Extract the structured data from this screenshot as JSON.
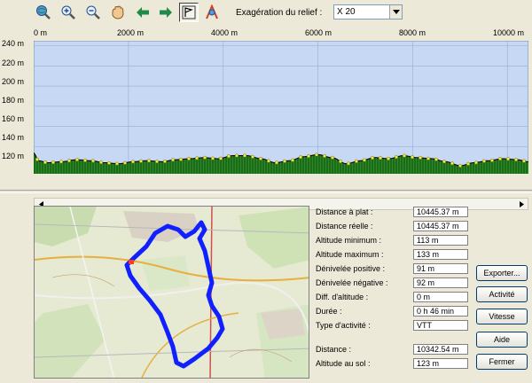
{
  "toolbar": {
    "icons": [
      "zoom-globe-icon",
      "zoom-in-icon",
      "zoom-out-icon",
      "hand-pan-icon",
      "arrow-left-icon",
      "arrow-right-icon",
      "flag-profile-icon",
      "measure-icon"
    ],
    "relief_label": "Exagération du relief :",
    "relief_value": "X 20"
  },
  "chart_data": {
    "type": "area",
    "xlabel": "",
    "ylabel": "",
    "x_ticks": [
      "0 m",
      "2000 m",
      "4000 m",
      "6000 m",
      "8000 m",
      "10000 m"
    ],
    "y_ticks": [
      "240 m",
      "220 m",
      "200 m",
      "180 m",
      "160 m",
      "140 m",
      "120 m"
    ],
    "xlim": [
      0,
      10445
    ],
    "ylim": [
      113,
      245
    ],
    "grid": true,
    "x": [
      0,
      100,
      300,
      600,
      900,
      1200,
      1500,
      1800,
      2100,
      2400,
      2700,
      3000,
      3300,
      3600,
      3900,
      4200,
      4500,
      4800,
      5100,
      5400,
      5700,
      6000,
      6300,
      6600,
      6900,
      7200,
      7500,
      7800,
      8100,
      8400,
      8700,
      9000,
      9300,
      9600,
      9900,
      10200,
      10445
    ],
    "altitude": [
      134,
      126,
      124,
      125,
      127,
      126,
      124,
      123,
      125,
      126,
      125,
      127,
      128,
      129,
      128,
      131,
      131,
      128,
      124,
      126,
      130,
      132,
      129,
      123,
      126,
      129,
      128,
      131,
      129,
      128,
      125,
      121,
      124,
      126,
      128,
      127,
      125
    ]
  },
  "map": {
    "label": "Map",
    "note": "IGN topographic base map"
  },
  "stats": [
    {
      "label": "Distance à plat :",
      "value": "10445.37 m"
    },
    {
      "label": "Distance réelle :",
      "value": "10445.37 m"
    },
    {
      "label": "Altitude minimum :",
      "value": "113 m"
    },
    {
      "label": "Altitude maximum :",
      "value": "133 m"
    },
    {
      "label": "Dénivelée positive :",
      "value": "91 m"
    },
    {
      "label": "Dénivelée négative :",
      "value": "92 m"
    },
    {
      "label": "Diff. d'altitude :",
      "value": "0 m"
    },
    {
      "label": "Durée :",
      "value": "0 h 46 min"
    },
    {
      "label": "Type d'activité :",
      "value": "VTT"
    },
    {
      "label": "Distance :",
      "value": "10342.54 m"
    },
    {
      "label": "Altitude au sol :",
      "value": "123 m"
    }
  ],
  "buttons": {
    "export": "Exporter...",
    "activity": "Activité",
    "speed": "Vitesse",
    "help": "Aide",
    "close": "Fermer"
  },
  "colors": {
    "sky": "#c7d8f5",
    "ground": "#2a8a26",
    "marker": "#f2e84a",
    "track": "#1020ff"
  }
}
